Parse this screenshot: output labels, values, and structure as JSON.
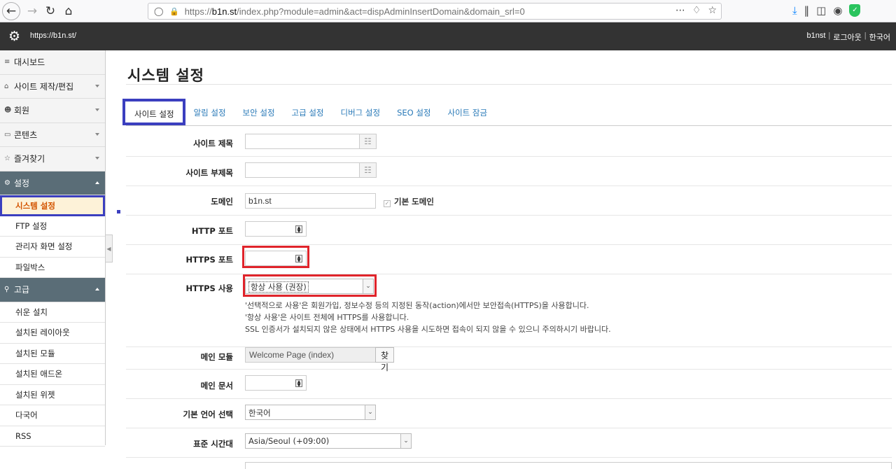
{
  "browser": {
    "url_prefix": "https://",
    "url_host": "b1n.st",
    "url_path": "/index.php?module=admin&act=dispAdminInsertDomain&domain_srl=0"
  },
  "header": {
    "site": "https://b1n.st/",
    "user": "b1nst",
    "logout": "로그아웃",
    "language": "한국어"
  },
  "sidebar": {
    "items": [
      {
        "label": "대시보드"
      },
      {
        "label": "사이트 제작/편집"
      },
      {
        "label": "회원"
      },
      {
        "label": "콘텐츠"
      },
      {
        "label": "즐겨찾기"
      },
      {
        "label": "설정"
      }
    ],
    "settings_sub": [
      "시스템 설정",
      "FTP 설정",
      "관리자 화면 설정",
      "파일박스"
    ],
    "advanced": "고급",
    "advanced_sub": [
      "쉬운 설치",
      "설치된 레이아웃",
      "설치된 모듈",
      "설치된 애드온",
      "설치된 위젯",
      "다국어",
      "RSS"
    ]
  },
  "page": {
    "title": "시스템 설정",
    "tabs": [
      "사이트 설정",
      "알림 설정",
      "보안 설정",
      "고급 설정",
      "디버그 설정",
      "SEO 설정",
      "사이트 잠금"
    ]
  },
  "form": {
    "site_title_label": "사이트 제목",
    "site_subtitle_label": "사이트 부제목",
    "domain_label": "도메인",
    "domain_value": "b1n.st",
    "default_domain_label": "기본 도메인",
    "http_port_label": "HTTP 포트",
    "https_port_label": "HTTPS 포트",
    "https_use_label": "HTTPS 사용",
    "https_use_value": "항상 사용 (권장)",
    "https_help": [
      "'선택적으로 사용'은 회원가입, 정보수정 등의 지정된 동작(action)에서만 보안접속(HTTPS)을 사용합니다.",
      "'항상 사용'은 사이트 전체에 HTTPS를 사용합니다.",
      "SSL 인증서가 설치되지 않은 상태에서 HTTPS 사용을 시도하면 접속이 되지 않을 수 있으니 주의하시기 바랍니다."
    ],
    "main_module_label": "메인 모듈",
    "main_module_value": "Welcome Page (index)",
    "find_button": "찾기",
    "main_document_label": "메인 문서",
    "default_lang_label": "기본 언어 선택",
    "default_lang_value": "한국어",
    "timezone_label": "표준 시간대",
    "timezone_value": "Asia/Seoul (+09:00)"
  }
}
